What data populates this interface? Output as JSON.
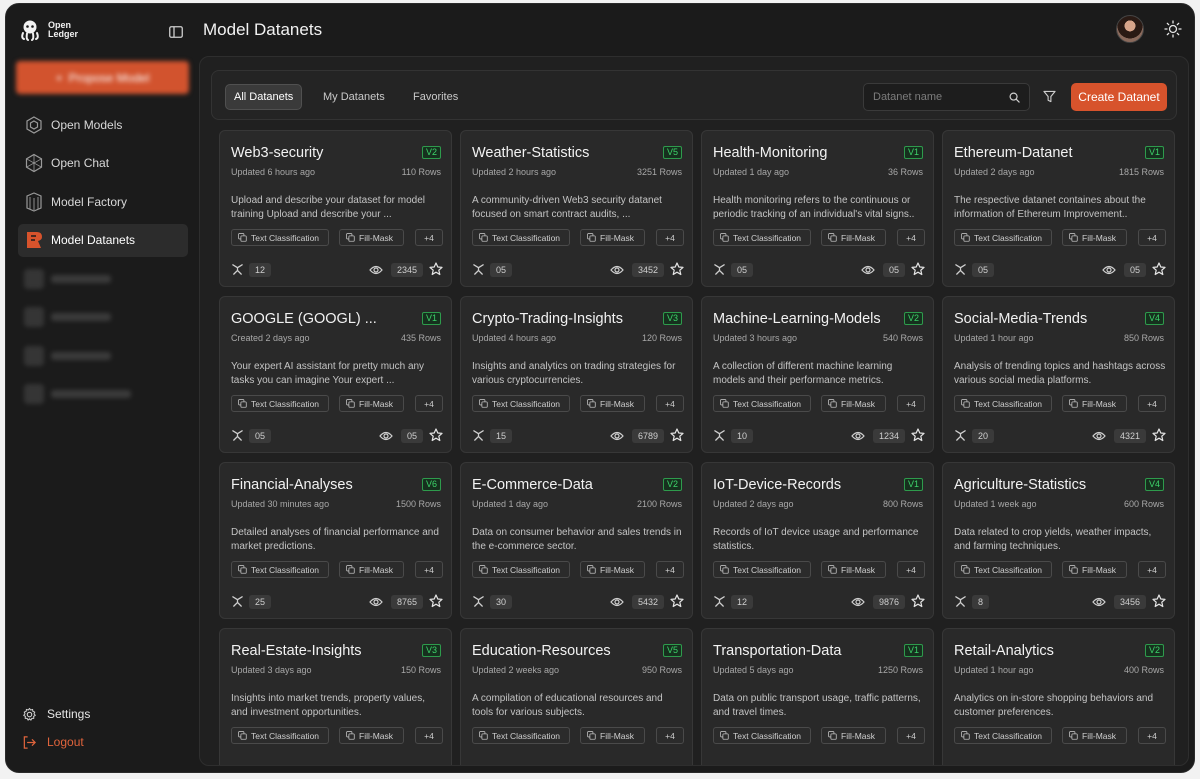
{
  "app": {
    "logo_line1": "Open",
    "logo_line2": "Ledger",
    "primary_action": "Propose Model"
  },
  "sidebar": {
    "items": [
      {
        "label": "Open Models",
        "icon": "open-models-icon",
        "active": false
      },
      {
        "label": "Open Chat",
        "icon": "open-chat-icon",
        "active": false
      },
      {
        "label": "Model Factory",
        "icon": "model-factory-icon",
        "active": false
      },
      {
        "label": "Model Datanets",
        "icon": "datanets-icon",
        "active": true
      }
    ],
    "blurred_count": 4,
    "settings_label": "Settings",
    "logout_label": "Logout"
  },
  "header": {
    "title": "Model Datanets"
  },
  "toolbar": {
    "tabs": [
      {
        "label": "All Datanets",
        "active": true
      },
      {
        "label": "My Datanets",
        "active": false
      },
      {
        "label": "Favorites",
        "active": false
      }
    ],
    "search_placeholder": "Datanet name",
    "create_label": "Create Datanet"
  },
  "colors": {
    "accent": "#d7532c",
    "version_green": "#3dd36a",
    "background": "#1b1b1b",
    "card": "#292929"
  },
  "cards": [
    {
      "title": "Web3-security",
      "version": "V2",
      "meta": "Updated 6 hours ago",
      "rows": "110 Rows",
      "desc": "Upload and describe your dataset for model training Upload and describe your ...",
      "tag1": "Text Classification",
      "tag2": "Fill-Mask",
      "more": "+4",
      "forks": "12",
      "views": "2345"
    },
    {
      "title": "Weather-Statistics",
      "version": "V5",
      "meta": "Updated 2 hours ago",
      "rows": "3251 Rows",
      "desc": "A community-driven Web3 security datanet focused on smart contract audits, ...",
      "tag1": "Text Classification",
      "tag2": "Fill-Mask",
      "more": "+4",
      "forks": "05",
      "views": "3452"
    },
    {
      "title": "Health-Monitoring",
      "version": "V1",
      "meta": "Updated 1 day ago",
      "rows": "36 Rows",
      "desc": "Health monitoring refers to the continuous or periodic tracking of an individual's vital signs..",
      "tag1": "Text Classification",
      "tag2": "Fill-Mask",
      "more": "+4",
      "forks": "05",
      "views": "05"
    },
    {
      "title": "Ethereum-Datanet",
      "version": "V1",
      "meta": "Updated 2 days ago",
      "rows": "1815 Rows",
      "desc": "The respective datanet containes about the information of Ethereum Improvement..",
      "tag1": "Text Classification",
      "tag2": "Fill-Mask",
      "more": "+4",
      "forks": "05",
      "views": "05"
    },
    {
      "title": "GOOGLE (GOOGL) ...",
      "version": "V1",
      "meta": "Created 2 days ago",
      "rows": "435 Rows",
      "desc": "Your expert AI assistant for  pretty much any tasks you can imagine Your expert ...",
      "tag1": "Text Classification",
      "tag2": "Fill-Mask",
      "more": "+4",
      "forks": "05",
      "views": "05"
    },
    {
      "title": "Crypto-Trading-Insights",
      "version": "V3",
      "meta": "Updated 4 hours ago",
      "rows": "120 Rows",
      "desc": "Insights and analytics on trading strategies for various cryptocurrencies.",
      "tag1": "Text Classification",
      "tag2": "Fill-Mask",
      "more": "+4",
      "forks": "15",
      "views": "6789"
    },
    {
      "title": "Machine-Learning-Models",
      "version": "V2",
      "meta": "Updated 3 hours ago",
      "rows": "540 Rows",
      "desc": "A collection of different machine learning models and their performance metrics.",
      "tag1": "Text Classification",
      "tag2": "Fill-Mask",
      "more": "+4",
      "forks": "10",
      "views": "1234"
    },
    {
      "title": "Social-Media-Trends",
      "version": "V4",
      "meta": "Updated 1 hour ago",
      "rows": "850 Rows",
      "desc": "Analysis of trending topics and hashtags across various social media platforms.",
      "tag1": "Text Classification",
      "tag2": "Fill-Mask",
      "more": "+4",
      "forks": "20",
      "views": "4321"
    },
    {
      "title": "Financial-Analyses",
      "version": "V6",
      "meta": "Updated 30 minutes ago",
      "rows": "1500 Rows",
      "desc": "Detailed analyses of financial performance and market predictions.",
      "tag1": "Text Classification",
      "tag2": "Fill-Mask",
      "more": "+4",
      "forks": "25",
      "views": "8765"
    },
    {
      "title": "E-Commerce-Data",
      "version": "V2",
      "meta": "Updated 1 day ago",
      "rows": "2100 Rows",
      "desc": "Data on consumer behavior and sales trends in the e-commerce sector.",
      "tag1": "Text Classification",
      "tag2": "Fill-Mask",
      "more": "+4",
      "forks": "30",
      "views": "5432"
    },
    {
      "title": "IoT-Device-Records",
      "version": "V1",
      "meta": "Updated 2 days ago",
      "rows": "800 Rows",
      "desc": "Records of IoT device usage and performance statistics.",
      "tag1": "Text Classification",
      "tag2": "Fill-Mask",
      "more": "+4",
      "forks": "12",
      "views": "9876"
    },
    {
      "title": "Agriculture-Statistics",
      "version": "V4",
      "meta": "Updated 1 week ago",
      "rows": "600 Rows",
      "desc": "Data related to crop yields, weather impacts, and farming techniques.",
      "tag1": "Text Classification",
      "tag2": "Fill-Mask",
      "more": "+4",
      "forks": "8",
      "views": "3456"
    },
    {
      "title": "Real-Estate-Insights",
      "version": "V3",
      "meta": "Updated 3 days ago",
      "rows": "150 Rows",
      "desc": "Insights into market trends, property values, and investment opportunities.",
      "tag1": "Text Classification",
      "tag2": "Fill-Mask",
      "more": "+4",
      "forks": "",
      "views": ""
    },
    {
      "title": "Education-Resources",
      "version": "V5",
      "meta": "Updated 2 weeks ago",
      "rows": "950 Rows",
      "desc": "A compilation of educational resources and tools for various subjects.",
      "tag1": "Text Classification",
      "tag2": "Fill-Mask",
      "more": "+4",
      "forks": "",
      "views": ""
    },
    {
      "title": "Transportation-Data",
      "version": "V1",
      "meta": "Updated 5 days ago",
      "rows": "1250 Rows",
      "desc": "Data on public transport usage, traffic patterns, and travel times.",
      "tag1": "Text Classification",
      "tag2": "Fill-Mask",
      "more": "+4",
      "forks": "",
      "views": ""
    },
    {
      "title": "Retail-Analytics",
      "version": "V2",
      "meta": "Updated 1 hour ago",
      "rows": "400 Rows",
      "desc": "Analytics on in-store shopping behaviors and customer preferences.",
      "tag1": "Text Classification",
      "tag2": "Fill-Mask",
      "more": "+4",
      "forks": "",
      "views": ""
    }
  ]
}
